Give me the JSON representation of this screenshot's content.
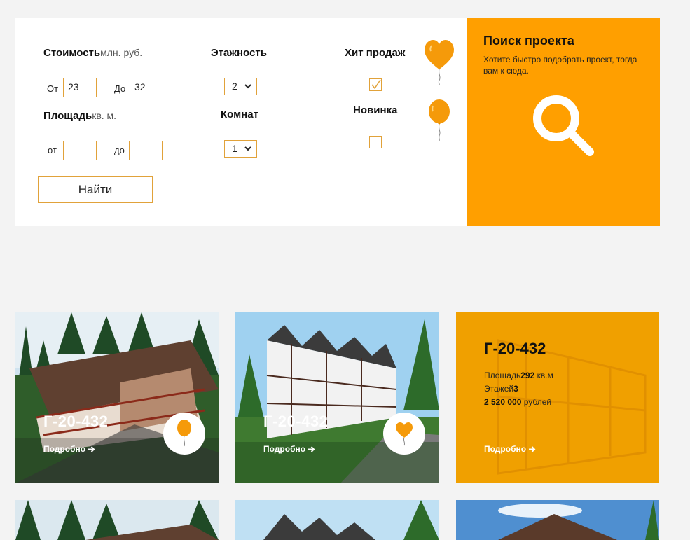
{
  "filters": {
    "cost": {
      "label": "Стоимость",
      "unit": "млн. руб.",
      "from_label": "От",
      "from_value": "23",
      "to_label": "До",
      "to_value": "32"
    },
    "area": {
      "label": "Площадь",
      "unit": "кв. м.",
      "from_label": "от",
      "from_value": "",
      "to_label": "до",
      "to_value": ""
    },
    "floors": {
      "label": "Этажность",
      "value": "2"
    },
    "rooms": {
      "label": "Комнат",
      "value": "1"
    },
    "hit": {
      "label": "Хит продаж",
      "checked": true
    },
    "new": {
      "label": "Новинка",
      "checked": false
    },
    "submit_label": "Найти"
  },
  "search_panel": {
    "title": "Поиск проекта",
    "description": "Хотите быстро подобрать проект, тогда вам к сюда.",
    "icon": "magnifier-icon"
  },
  "cards": [
    {
      "title": "Г-20-432",
      "more_label": "Подробно",
      "badge_icon": "balloon-icon"
    },
    {
      "title": "Г-20-432",
      "more_label": "Подробно",
      "badge_icon": "heart-balloon-icon"
    },
    {
      "title": "Г-20-432",
      "area_label": "Площадь",
      "area_value": "292",
      "area_unit": "кв.м",
      "floors_label": "Этажей",
      "floors_value": "3",
      "price_value": "2 520 000",
      "price_unit": "рублей",
      "more_label": "Подробно"
    }
  ],
  "colors": {
    "accent": "#ff9f00",
    "accent_border": "#e1a23a",
    "background": "#f3f3f3"
  }
}
